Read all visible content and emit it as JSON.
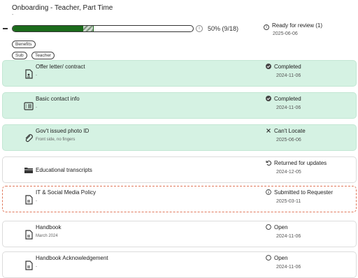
{
  "header": {
    "title": "Onboarding - Teacher, Part Time",
    "subtitle": "-",
    "progress_text": "50% (9/18)",
    "progress_fraction": 0.5,
    "review_status": "Ready for review (1)",
    "review_date": "2025-06-06",
    "tags_row1": [
      "Benefits"
    ],
    "tags_row2": [
      "Sub",
      "Teacher"
    ]
  },
  "colors": {
    "progress": "#1b6b1b",
    "completed_bg": "#d5f2e3",
    "dashed_border": "#e0775a"
  },
  "items": [
    {
      "name": "Offer letter/ contract",
      "desc": "-",
      "status": "Completed",
      "date": "2024-11-06",
      "icon": "document-signature-icon",
      "status_icon": "check-circle-icon"
    },
    {
      "name": "Basic contact info",
      "desc": "-",
      "status": "Completed",
      "date": "2024-11-06",
      "icon": "list-card-icon",
      "status_icon": "check-circle-icon"
    },
    {
      "name": "Gov't issued photo ID",
      "desc": "Front side, no fingers",
      "status": "Can't Locate",
      "date": "2025-06-06",
      "icon": "paperclip-icon",
      "status_icon": "x-icon"
    },
    {
      "name": "Educational transcripts",
      "desc": "",
      "status": "Returned for updates",
      "date": "2024-12-05",
      "icon": "folder-icon",
      "status_icon": "undo-icon"
    },
    {
      "name": "IT & Social Media Policy",
      "desc": "-",
      "status": "Submitted to Requester",
      "date": "2025-03-11",
      "icon": "document-icon",
      "status_icon": "info-circle-icon"
    },
    {
      "name": "Handbook",
      "desc": "March 2024",
      "status": "Open",
      "date": "2024-11-06",
      "icon": "document-icon",
      "status_icon": "circle-icon"
    },
    {
      "name": "Handbook Acknowledgement",
      "desc": "-",
      "status": "Open",
      "date": "2024-11-06",
      "icon": "document-icon",
      "status_icon": "circle-icon"
    }
  ]
}
